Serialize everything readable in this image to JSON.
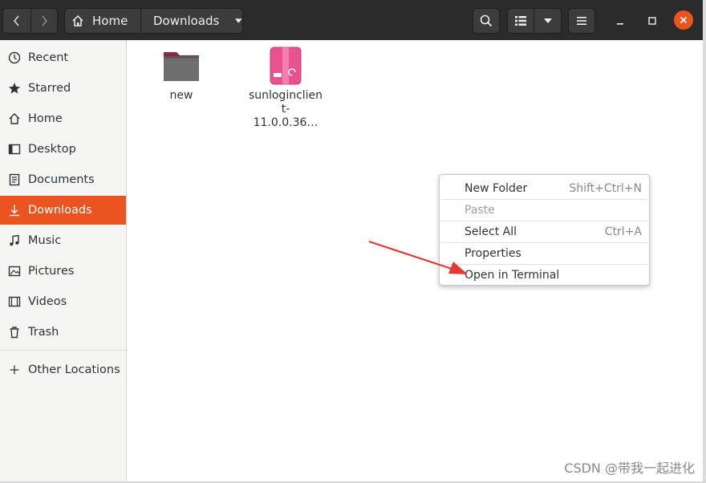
{
  "header": {
    "path": [
      {
        "label": "Home",
        "icon": "home-icon"
      },
      {
        "label": "Downloads",
        "icon": "chevron-down-icon"
      }
    ]
  },
  "sidebar": {
    "items": [
      {
        "label": "Recent",
        "icon": "clock-icon"
      },
      {
        "label": "Starred",
        "icon": "star-icon"
      },
      {
        "label": "Home",
        "icon": "home-icon"
      },
      {
        "label": "Desktop",
        "icon": "desktop-icon"
      },
      {
        "label": "Documents",
        "icon": "document-icon"
      },
      {
        "label": "Downloads",
        "icon": "download-icon",
        "active": true
      },
      {
        "label": "Music",
        "icon": "music-icon"
      },
      {
        "label": "Pictures",
        "icon": "picture-icon"
      },
      {
        "label": "Videos",
        "icon": "video-icon"
      },
      {
        "label": "Trash",
        "icon": "trash-icon"
      },
      {
        "label": "Other Locations",
        "icon": "plus-icon"
      }
    ]
  },
  "files": [
    {
      "name": "new",
      "type": "folder-icon"
    },
    {
      "name": "sunloginclient-\n11.0.0.36…",
      "type": "package-icon"
    }
  ],
  "context_menu": {
    "items": [
      {
        "label": "New Folder",
        "shortcut": "Shift+Ctrl+N",
        "enabled": true
      },
      {
        "label": "Paste",
        "shortcut": "",
        "enabled": false
      },
      {
        "label": "Select All",
        "shortcut": "Ctrl+A",
        "enabled": true
      },
      {
        "label": "Properties",
        "shortcut": "",
        "enabled": true
      },
      {
        "label": "Open in Terminal",
        "shortcut": "",
        "enabled": true
      }
    ]
  },
  "watermark": "CSDN @带我一起进化",
  "colors": {
    "accent": "#e95420",
    "headerbar": "#2b2b2b",
    "annotation_arrow": "#e53935"
  }
}
